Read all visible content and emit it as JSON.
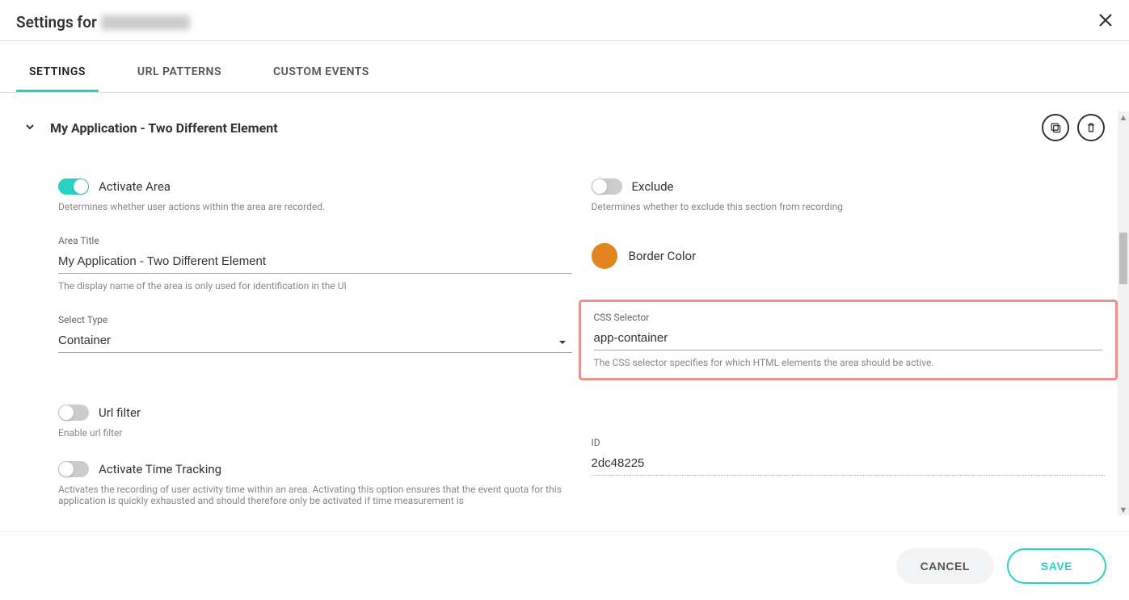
{
  "header": {
    "title_prefix": "Settings for"
  },
  "tabs": [
    {
      "label": "SETTINGS",
      "active": true
    },
    {
      "label": "URL PATTERNS",
      "active": false
    },
    {
      "label": "CUSTOM EVENTS",
      "active": false
    }
  ],
  "section": {
    "title": "My Application - Two Different Element",
    "activate_area": {
      "label": "Activate Area",
      "on": true,
      "help": "Determines whether user actions within the area are recorded."
    },
    "exclude": {
      "label": "Exclude",
      "on": false,
      "help": "Determines whether to exclude this section from recording"
    },
    "area_title": {
      "label": "Area Title",
      "value": "My Application - Two Different Element",
      "help": "The display name of the area is only used for identification in the UI"
    },
    "border_color": {
      "label": "Border Color",
      "value": "#e28520"
    },
    "select_type": {
      "label": "Select Type",
      "value": "Container"
    },
    "css_selector": {
      "label": "CSS Selector",
      "value": "app-container",
      "help": "The CSS selector specifies for which HTML elements the area should be active."
    },
    "url_filter": {
      "label": "Url filter",
      "on": false,
      "help": "Enable url filter"
    },
    "time_tracking": {
      "label": "Activate Time Tracking",
      "on": false,
      "help": "Activates the recording of user activity time within an area. Activating this option ensures that the event quota for this application is quickly exhausted and should therefore only be activated if time measurement is"
    },
    "id": {
      "label": "ID",
      "value": "2dc48225"
    }
  },
  "footer": {
    "cancel": "CANCEL",
    "save": "SAVE"
  }
}
